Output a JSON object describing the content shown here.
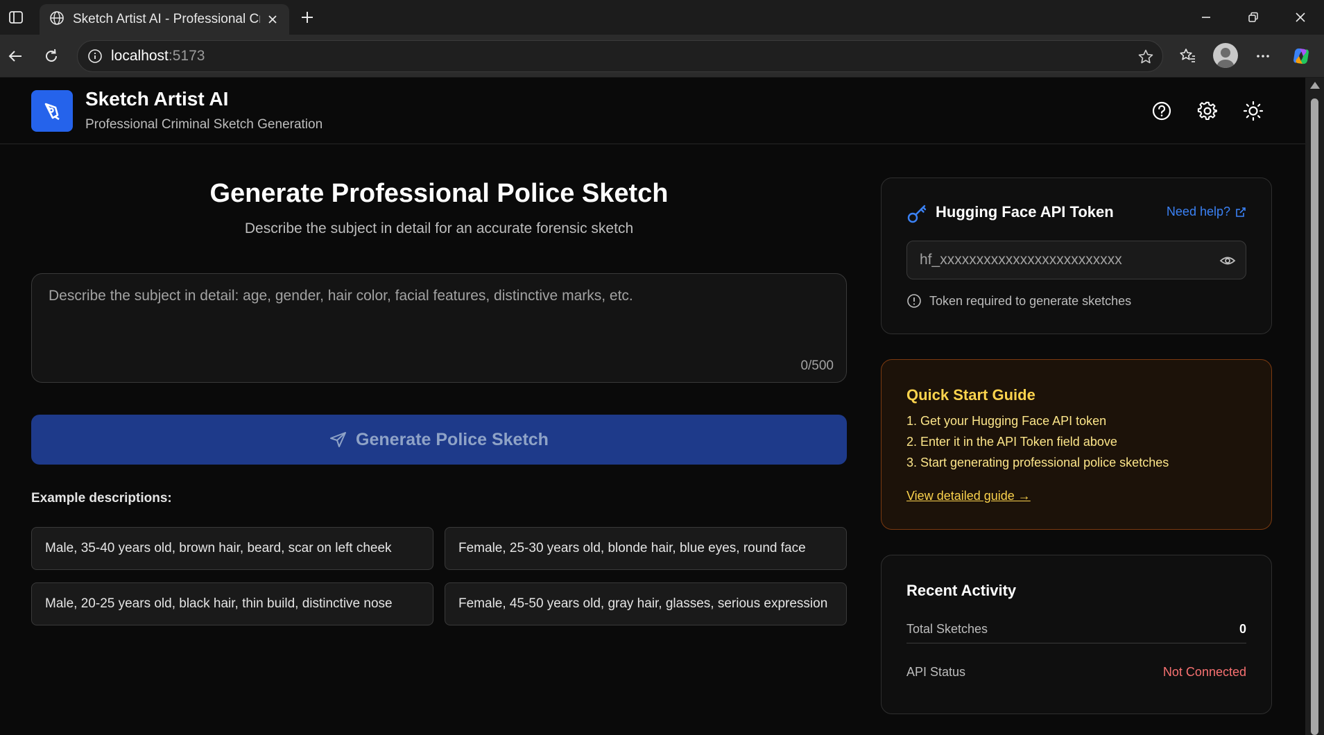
{
  "browser": {
    "tab_title": "Sketch Artist AI - Professional Criminal Sketch Generation",
    "url_host": "localhost",
    "url_port": ":5173"
  },
  "header": {
    "title": "Sketch Artist AI",
    "subtitle": "Professional Criminal Sketch Generation"
  },
  "main": {
    "title": "Generate Professional Police Sketch",
    "subtitle": "Describe the subject in detail for an accurate forensic sketch",
    "description_placeholder": "Describe the subject in detail: age, gender, hair color, facial features, distinctive marks, etc.",
    "description_value": "",
    "char_count": "0/500",
    "generate_label": "Generate Police Sketch",
    "examples_label": "Example descriptions:",
    "examples": [
      "Male, 35-40 years old, brown hair, beard, scar on left cheek",
      "Female, 25-30 years old, blonde hair, blue eyes, round face",
      "Male, 20-25 years old, black hair, thin build, distinctive nose",
      "Female, 45-50 years old, gray hair, glasses, serious expression"
    ]
  },
  "token_card": {
    "title": "Hugging Face API Token",
    "help_label": "Need help?",
    "placeholder": "hf_xxxxxxxxxxxxxxxxxxxxxxxxx",
    "value": "",
    "note": "Token required to generate sketches"
  },
  "guide_card": {
    "title": "Quick Start Guide",
    "steps": [
      "1. Get your Hugging Face API token",
      "2. Enter it in the API Token field above",
      "3. Start generating professional police sketches"
    ],
    "link": "View detailed guide →"
  },
  "activity_card": {
    "title": "Recent Activity",
    "total_label": "Total Sketches",
    "total_value": "0",
    "status_label": "API Status",
    "status_value": "Not Connected"
  },
  "colors": {
    "accent": "#2563eb",
    "button_bg": "#1e3a8a",
    "guide_text": "#fcd34d",
    "error": "#f87171",
    "link": "#3b82f6"
  }
}
